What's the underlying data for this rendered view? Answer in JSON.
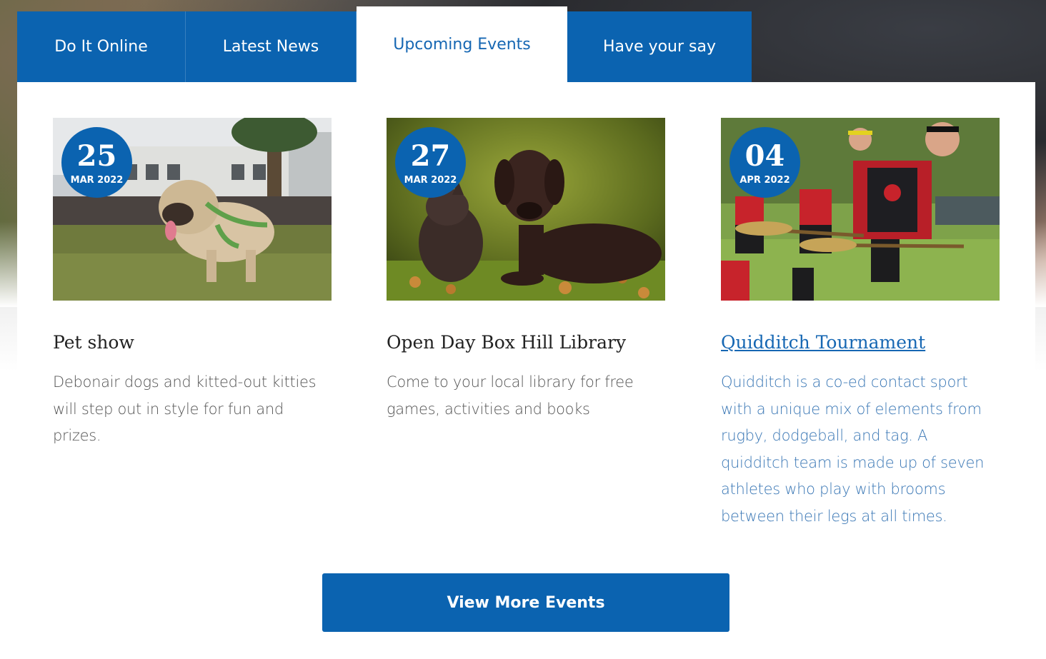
{
  "tabs": [
    {
      "label": "Do It Online",
      "active": false
    },
    {
      "label": "Latest News",
      "active": false
    },
    {
      "label": "Upcoming Events",
      "active": true
    },
    {
      "label": "Have your say",
      "active": false
    }
  ],
  "events": [
    {
      "day": "25",
      "month": "MAR 2022",
      "title": "Pet show",
      "description": "Debonair dogs and kitted-out kitties will step out in style for fun and prizes.",
      "image_icon": "dog-photo-icon"
    },
    {
      "day": "27",
      "month": "MAR 2022",
      "title": "Open Day Box Hill Library",
      "description": "Come to your local library for free games, activities and books",
      "image_icon": "dog-and-cat-photo-icon"
    },
    {
      "day": "04",
      "month": "APR 2022",
      "title": "Quidditch Tournament",
      "description": "Quidditch is a co-ed contact sport with a unique mix of elements from rugby, dodgeball, and tag. A quidditch team is made up of seven athletes who play with brooms between their legs at all times.",
      "image_icon": "quidditch-players-photo-icon"
    }
  ],
  "cta": {
    "label": "View More Events"
  },
  "colors": {
    "brand_blue": "#0b63b0",
    "link_blue": "#1667b3"
  }
}
